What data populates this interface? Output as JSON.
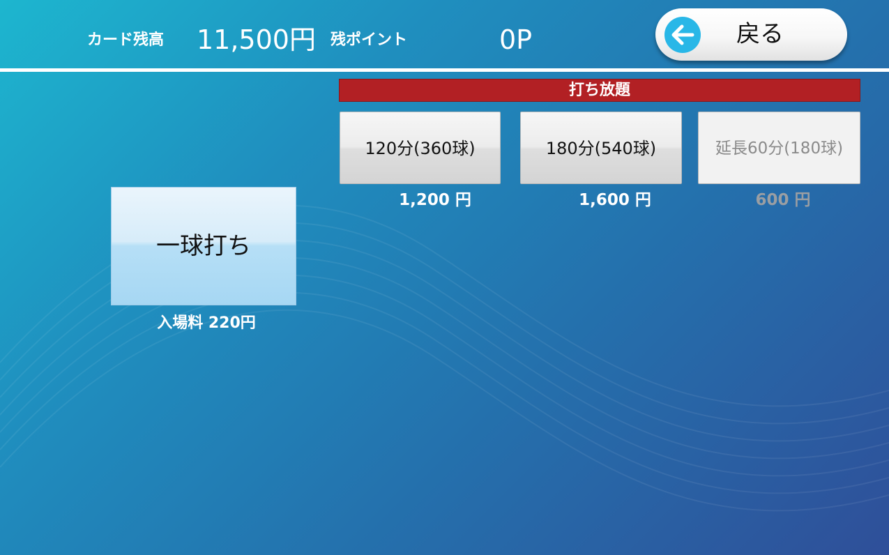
{
  "header": {
    "card_balance_label": "カード残高",
    "card_balance_value": "11,500円",
    "points_label": "残ポイント",
    "points_value": "0P",
    "back_button_label": "戻る",
    "back_icon": "arrow-left-icon"
  },
  "plans_section": {
    "title": "打ち放題",
    "plans": [
      {
        "label": "120分(360球)",
        "price": "1,200 円",
        "enabled": true
      },
      {
        "label": "180分(540球)",
        "price": "1,600 円",
        "enabled": true
      },
      {
        "label": "延長60分(180球)",
        "price": "600 円",
        "enabled": false
      }
    ]
  },
  "single_play": {
    "label": "一球打ち",
    "entry_fee": "入場料 220円"
  },
  "colors": {
    "background_start": "#1db6cf",
    "background_end": "#2f4f99",
    "section_bar": "#b22024",
    "back_icon": "#29b7e7",
    "disabled_text": "#8a8a8a"
  }
}
